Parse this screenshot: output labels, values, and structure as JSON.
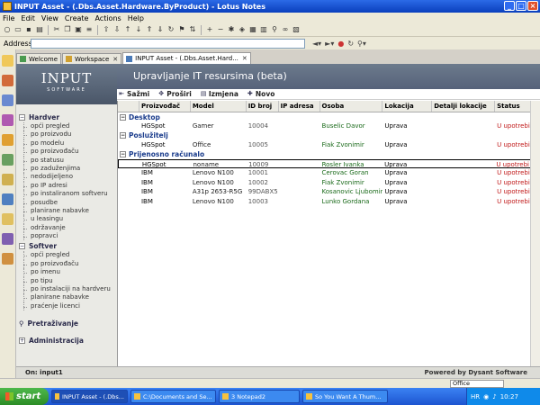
{
  "window": {
    "title": "INPUT Asset - (.Dbs.Asset.Hardware.ByProduct) - Lotus Notes"
  },
  "menu": [
    "File",
    "Edit",
    "View",
    "Create",
    "Actions",
    "Help"
  ],
  "address": {
    "label": "Address",
    "value": ""
  },
  "tabs": [
    {
      "label": "Welcome",
      "active": false
    },
    {
      "label": "Workspace",
      "active": false
    },
    {
      "label": "INPUT Asset - (.Dbs.Asset.Hard...",
      "active": true
    }
  ],
  "logo": {
    "main": "INPUT",
    "sub": "SOFTWARE"
  },
  "header": {
    "title": "Upravljanje IT resursima (beta)"
  },
  "actions": [
    {
      "label": "Sažmi",
      "icon": "collapse-icon"
    },
    {
      "label": "Proširi",
      "icon": "expand-icon"
    },
    {
      "label": "Izmjena",
      "icon": "edit-icon"
    },
    {
      "label": "Novo",
      "icon": "new-icon"
    }
  ],
  "nav": {
    "hardver": {
      "label": "Hardver",
      "items": [
        "opći pregled",
        "po proizvodu",
        "po modelu",
        "po proizvođaču",
        "po statusu",
        "po zaduženjima",
        "nedodijeljeno",
        "po IP adresi",
        "po instaliranom softveru",
        "posudbe",
        "planirane nabavke",
        "u leasingu",
        "održavanje",
        "popravci"
      ]
    },
    "softver": {
      "label": "Softver",
      "items": [
        "opći pregled",
        "po proizvođaču",
        "po imenu",
        "po tipu",
        "po instalaciji na hardveru",
        "planirane nabavke",
        "praćenje licenci"
      ]
    },
    "pretrazivanje": {
      "label": "Pretraživanje"
    },
    "administracija": {
      "label": "Administracija"
    }
  },
  "table": {
    "columns": [
      "Proizvođač",
      "Model",
      "ID broj",
      "IP adresa",
      "Osoba",
      "Lokacija",
      "Detalji lokacije",
      "Status"
    ],
    "categories": [
      {
        "name": "Desktop",
        "rows": [
          [
            "HGSpot",
            "Gamer",
            "10004",
            "",
            "Buselic Davor",
            "Uprava",
            "",
            "U upotrebi"
          ]
        ]
      },
      {
        "name": "Poslužitelj",
        "rows": [
          [
            "HGSpot",
            "Office",
            "10005",
            "",
            "Fiak Zvonimir",
            "Uprava",
            "",
            "U upotrebi"
          ]
        ]
      },
      {
        "name": "Prijenosno računalo",
        "rows": [
          [
            "HGSpot",
            "noname",
            "10009",
            "",
            "Rosler Ivanka",
            "Uprava",
            "",
            "U upotrebi"
          ],
          [
            "IBM",
            "Lenovo N100",
            "10001",
            "",
            "Cerovac Goran",
            "Uprava",
            "",
            "U upotrebi"
          ],
          [
            "IBM",
            "Lenovo N100",
            "10002",
            "",
            "Fiak Zvonimir",
            "Uprava",
            "",
            "U upotrebi"
          ],
          [
            "IBM",
            "A31p 2653-R5G",
            "99DABX5",
            "",
            "Kosanovic Ljubomir",
            "Uprava",
            "",
            "U upotrebi"
          ],
          [
            "IBM",
            "Lenovo N100",
            "10003",
            "",
            "Lunko Gordana",
            "Uprava",
            "",
            "U upotrebi"
          ]
        ]
      }
    ]
  },
  "status": {
    "left": "On: input1",
    "right": "Powered by Dysant Software"
  },
  "notes_status": {
    "location": "Office"
  },
  "taskbar": {
    "start": "start",
    "buttons": [
      {
        "label": "INPUT Asset - (.Dbs...",
        "active": true
      },
      {
        "label": "C:\\Documents and Se...",
        "active": false
      },
      {
        "label": "3 Notepad2",
        "active": false
      },
      {
        "label": "So You Want A Thum...",
        "active": false
      }
    ],
    "lang": "HR",
    "clock": "10:27"
  },
  "colors": {
    "title_blue": "#0a3fbd",
    "header_slate": "#5c687c",
    "category_blue": "#1a3c8c",
    "person_green": "#1a6a1a",
    "status_red": "#c01818"
  }
}
